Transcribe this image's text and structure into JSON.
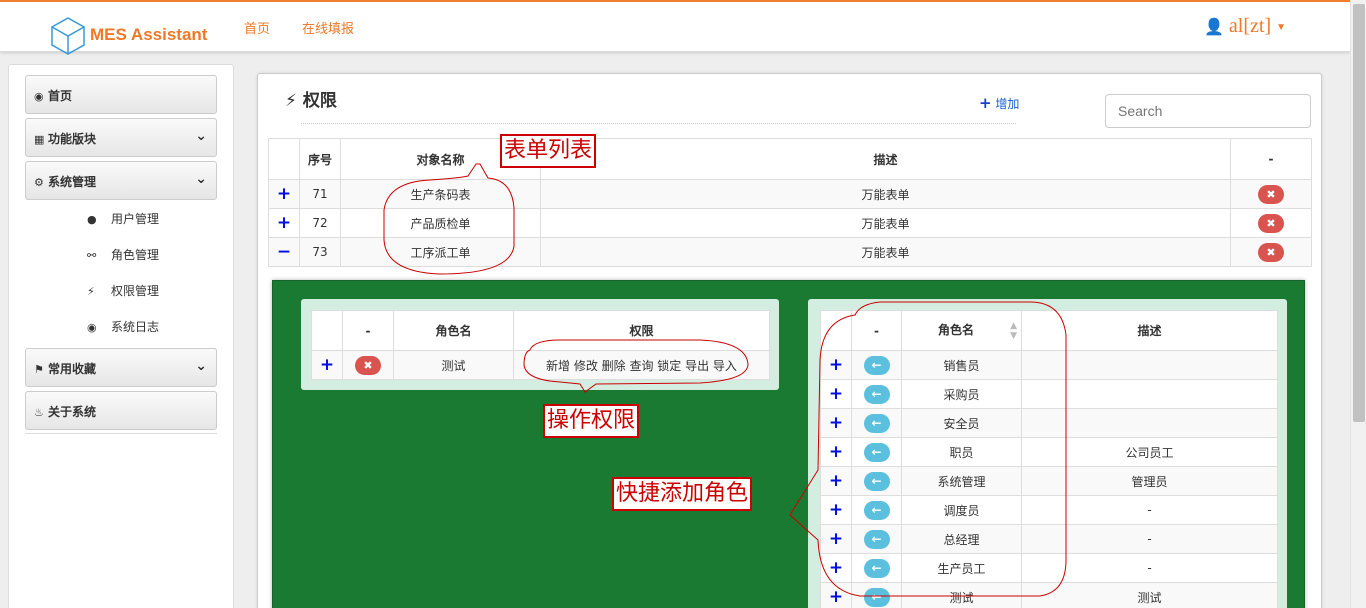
{
  "header": {
    "brand": "MES Assistant",
    "nav": [
      "首页",
      "在线填报"
    ],
    "user": "al[zt]"
  },
  "sidebar": {
    "items": [
      {
        "label": "首页",
        "icon": "dashboard-icon"
      },
      {
        "label": "功能版块",
        "icon": "grid-icon"
      },
      {
        "label": "系统管理",
        "icon": "gear-icon"
      },
      {
        "label": "常用收藏",
        "icon": "tags-icon"
      },
      {
        "label": "关于系统",
        "icon": "fire-icon"
      }
    ],
    "submenu": [
      {
        "label": "用户管理",
        "icon": "user-icon"
      },
      {
        "label": "角色管理",
        "icon": "glasses-icon"
      },
      {
        "label": "权限管理",
        "icon": "bolt-icon"
      },
      {
        "label": "系统日志",
        "icon": "eye-icon"
      }
    ]
  },
  "page": {
    "title": "权限",
    "add_label": "增加",
    "search_placeholder": "Search"
  },
  "forms_table": {
    "headers": [
      "序号",
      "对象名称",
      "描述",
      "-"
    ],
    "rows": [
      {
        "toggle": "+",
        "id": "71",
        "name": "生产条码表",
        "desc": "万能表单"
      },
      {
        "toggle": "+",
        "id": "72",
        "name": "产品质检单",
        "desc": "万能表单"
      },
      {
        "toggle": "−",
        "id": "73",
        "name": "工序派工单",
        "desc": "万能表单"
      }
    ]
  },
  "permission_table": {
    "headers": [
      "-",
      "角色名",
      "权限"
    ],
    "rows": [
      {
        "role": "测试",
        "permissions": "新增 修改 删除 查询 锁定 导出 导入"
      }
    ]
  },
  "roles_table": {
    "headers": [
      "-",
      "角色名",
      "描述"
    ],
    "rows": [
      {
        "role": "销售员",
        "desc": ""
      },
      {
        "role": "采购员",
        "desc": ""
      },
      {
        "role": "安全员",
        "desc": ""
      },
      {
        "role": "职员",
        "desc": "公司员工"
      },
      {
        "role": "系统管理",
        "desc": "管理员"
      },
      {
        "role": "调度员",
        "desc": "-"
      },
      {
        "role": "总经理",
        "desc": "-"
      },
      {
        "role": "生产员工",
        "desc": "-"
      },
      {
        "role": "测试",
        "desc": "测试"
      }
    ]
  },
  "annotations": {
    "form_list": "表单列表",
    "operation_permission": "操作权限",
    "quick_add_role": "快捷添加角色"
  },
  "colors": {
    "accent": "#f07828",
    "panel_green": "#1a7a32",
    "annotation_red": "#cc0000",
    "delete_red": "#d9534f",
    "action_blue": "#5bc0de"
  }
}
